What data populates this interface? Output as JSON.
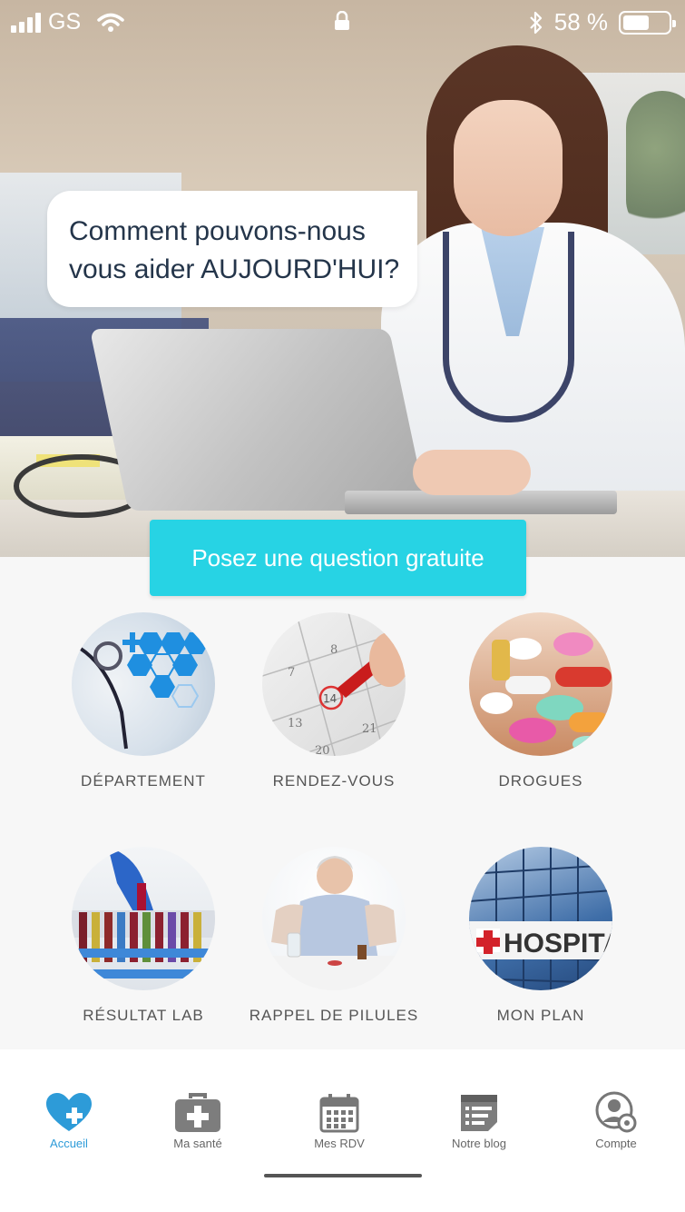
{
  "status_bar": {
    "carrier": "GS",
    "battery": "58 %",
    "battery_level": 0.58,
    "icons": [
      "signal-icon",
      "wifi-icon",
      "lock-icon",
      "bluetooth-icon",
      "battery-icon"
    ]
  },
  "hero": {
    "bubble_line1": "Comment pouvons-nous",
    "bubble_line2": "vous aider AUJOURD'HUI?",
    "cta_label": "Posez une question gratuite"
  },
  "services": [
    {
      "label": "DÉPARTEMENT"
    },
    {
      "label": "RENDEZ-VOUS"
    },
    {
      "label": "DROGUES"
    },
    {
      "label": "RÉSULTAT LAB"
    },
    {
      "label": "RAPPEL DE PILULES"
    },
    {
      "label": "MON PLAN"
    }
  ],
  "hospital_sign": "HOSPITA",
  "bottom_nav": [
    {
      "label": "Accueil",
      "icon": "heart-plus-icon",
      "active": true
    },
    {
      "label": "Ma santé",
      "icon": "medical-bag-icon",
      "active": false
    },
    {
      "label": "Mes RDV",
      "icon": "calendar-icon",
      "active": false
    },
    {
      "label": "Notre blog",
      "icon": "blog-icon",
      "active": false
    },
    {
      "label": "Compte",
      "icon": "account-gear-icon",
      "active": false
    }
  ],
  "colors": {
    "accent": "#27d3e4",
    "active_nav": "#2d9bd8",
    "bubble_text": "#24354a"
  }
}
